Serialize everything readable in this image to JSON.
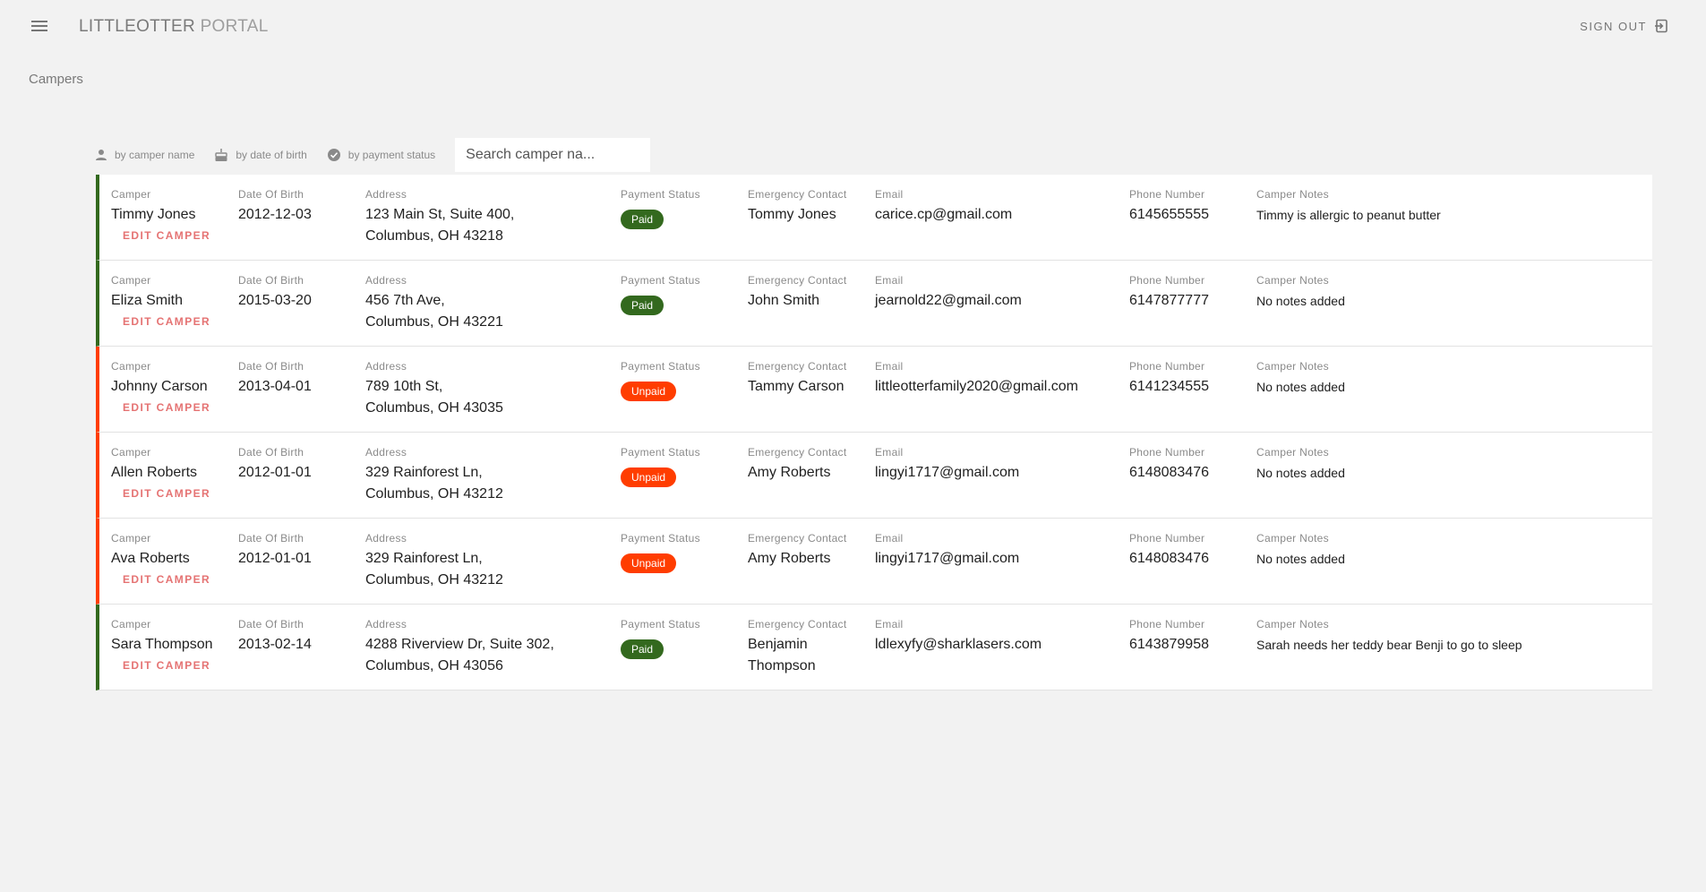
{
  "app": {
    "title_bold": "LITTLEOTTER",
    "title_light": " PORTAL",
    "sign_out_label": "SIGN OUT"
  },
  "page": {
    "title": "Campers"
  },
  "filters": {
    "by_name": "by camper name",
    "by_dob": "by date of birth",
    "by_payment": "by payment status",
    "search_placeholder": "Search camper na..."
  },
  "labels": {
    "camper": "Camper",
    "dob": "Date Of Birth",
    "address": "Address",
    "payment": "Payment Status",
    "emergency": "Emergency Contact",
    "email": "Email",
    "phone": "Phone Number",
    "notes": "Camper Notes",
    "edit": "EDIT CAMPER"
  },
  "colors": {
    "paid": "#33691e",
    "unpaid": "#ff3d00",
    "edit": "#e57373"
  },
  "campers": [
    {
      "name": "Timmy Jones",
      "dob": "2012-12-03",
      "address_line1": "123 Main St,  Suite 400,",
      "address_line2": "Columbus,  OH  43218",
      "payment": "Paid",
      "emergency": "Tommy Jones",
      "email": "carice.cp@gmail.com",
      "phone": "6145655555",
      "notes": "Timmy is allergic to peanut butter"
    },
    {
      "name": "Eliza Smith",
      "dob": "2015-03-20",
      "address_line1": "456 7th Ave,",
      "address_line2": "Columbus,  OH  43221",
      "payment": "Paid",
      "emergency": "John Smith",
      "email": "jearnold22@gmail.com",
      "phone": "6147877777",
      "notes": "No notes added"
    },
    {
      "name": "Johnny Carson",
      "dob": "2013-04-01",
      "address_line1": "789 10th St,",
      "address_line2": "Columbus,  OH  43035",
      "payment": "Unpaid",
      "emergency": "Tammy Carson",
      "email": "littleotterfamily2020@gmail.com",
      "phone": "6141234555",
      "notes": "No notes added"
    },
    {
      "name": "Allen Roberts",
      "dob": "2012-01-01",
      "address_line1": "329 Rainforest Ln,",
      "address_line2": "Columbus,  OH  43212",
      "payment": "Unpaid",
      "emergency": "Amy Roberts",
      "email": "lingyi1717@gmail.com",
      "phone": "6148083476",
      "notes": "No notes added"
    },
    {
      "name": "Ava Roberts",
      "dob": "2012-01-01",
      "address_line1": "329 Rainforest Ln,",
      "address_line2": "Columbus,  OH  43212",
      "payment": "Unpaid",
      "emergency": "Amy Roberts",
      "email": "lingyi1717@gmail.com",
      "phone": "6148083476",
      "notes": "No notes added"
    },
    {
      "name": "Sara Thompson",
      "dob": "2013-02-14",
      "address_line1": "4288 Riverview Dr,  Suite 302,",
      "address_line2": "Columbus,  OH  43056",
      "payment": "Paid",
      "emergency": "Benjamin Thompson",
      "email": "ldlexyfy@sharklasers.com",
      "phone": "6143879958",
      "notes": "Sarah needs her teddy bear Benji to go to sleep"
    }
  ]
}
